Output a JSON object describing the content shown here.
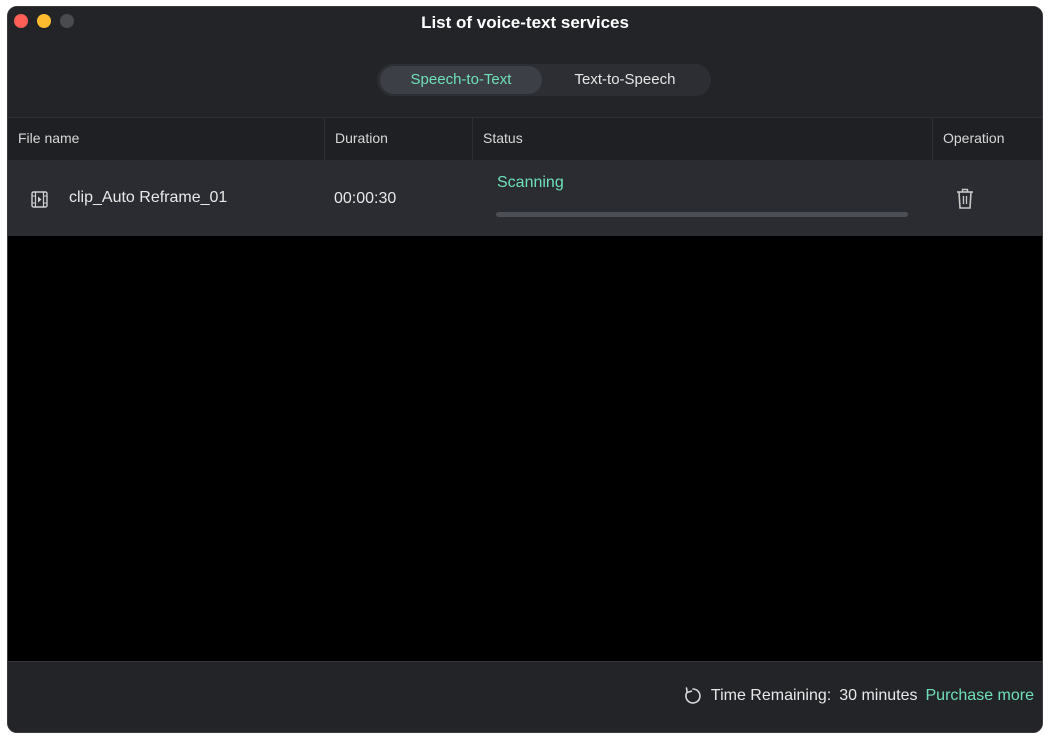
{
  "window": {
    "title": "List of voice-text services"
  },
  "tabs": [
    {
      "label": "Speech-to-Text",
      "active": true
    },
    {
      "label": "Text-to-Speech",
      "active": false
    }
  ],
  "table": {
    "columns": [
      "File name",
      "Duration",
      "Status",
      "Operation"
    ],
    "rows": [
      {
        "file_icon": "film-clip-icon",
        "file_name": "clip_Auto Reframe_01",
        "duration": "00:00:30",
        "status": "Scanning",
        "progress": 0,
        "operation_icon": "trash-icon"
      }
    ]
  },
  "footer": {
    "refresh_icon": "refresh-icon",
    "time_remaining_label": "Time Remaining:",
    "time_remaining_value": "30 minutes",
    "purchase_label": "Purchase more"
  },
  "colors": {
    "accent": "#6fe0b8",
    "background": "#000000",
    "panel": "#232428",
    "row": "#2a2c31"
  }
}
